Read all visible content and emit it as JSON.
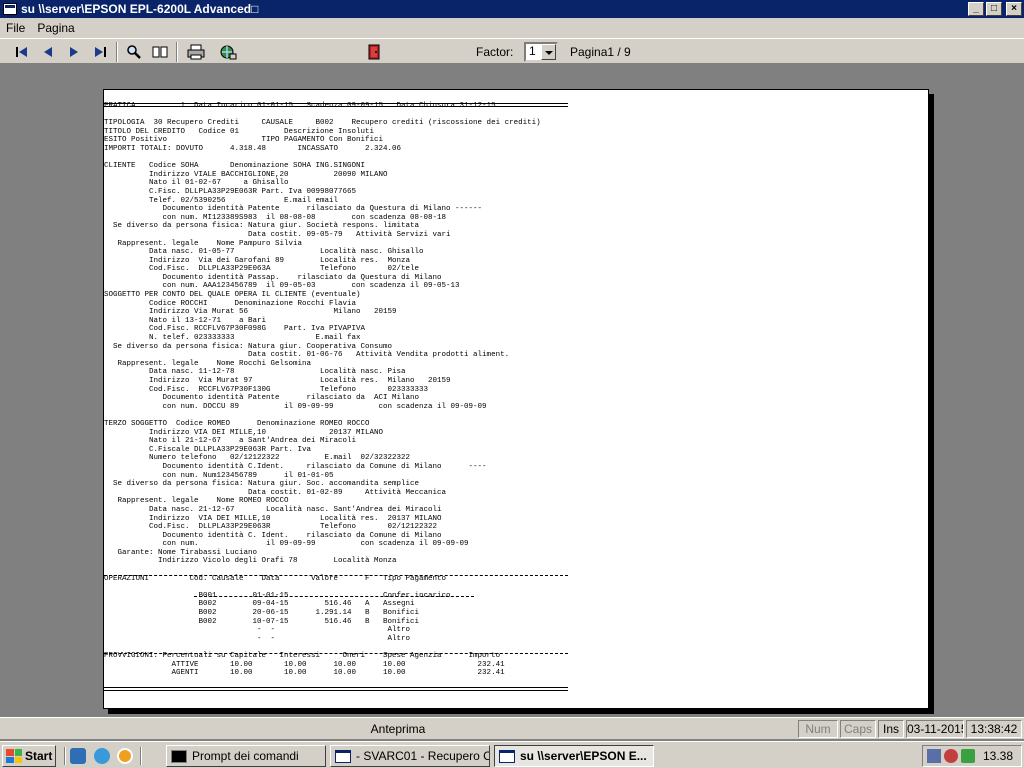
{
  "window": {
    "title": "su \\\\server\\EPSON EPL-6200L Advanced□"
  },
  "menu": [
    "File",
    "Pagina"
  ],
  "toolbar": {
    "factor_label": "Factor:",
    "factor_value": "1",
    "page_label": "Pagina1 / 9"
  },
  "report_lines": [
    "PRATICA          1  Data Incarico 01-01-15   Scadenza 09-09-15   Data Chiusura 31-12-15",
    "",
    "TIPOLOGIA  30 Recupero Crediti     CAUSALE     B002    Recupero crediti (riscossione dei crediti)",
    "TITOLO DEL CREDITO   Codice 01          Descrizione Insoluti",
    "ESITO Positivo                     TIPO PAGAMENTO Con Bonifici",
    "IMPORTI TOTALI: DOVUTO      4.318.48       INCASSATO      2.324.06",
    "",
    "CLIENTE   Codice SOHA       Denominazione SOHA ING.SINGONI",
    "          Indirizzo VIALE BACCHIGLIONE,20          20090 MILANO",
    "          Nato il 01-02-67     a Ghisallo",
    "          C.Fisc. DLLPLA33P29E063R Part. Iva 00998077665",
    "          Telef. 02/5390256             E.mail email",
    "             Documento identità Patente      rilasciato da Questura di Milano ------",
    "             con num. MI123389S983  il 08-08-08        con scadenza 08-08-18",
    "  Se diverso da persona fisica: Natura giur. Società respons. limitata",
    "                                Data costit. 09-05-79   Attività Servizi vari",
    "   Rappresent. legale    Nome Pampuro Silvia",
    "          Data nasc. 01-05-77                   Località nasc. Ghisallo",
    "          Indirizzo  Via dei Garofani 89        Località res.  Monza",
    "          Cod.Fisc.  DLLPLA33P29E063A           Telefono       02/tele",
    "             Documento identità Passap.    rilasciato da Questura di Milano",
    "             con num. AAA123456789  il 09-05-03        con scadenza il 09-05-13",
    "SOGGETTO PER CONTO DEL QUALE OPERA IL CLIENTE (eventuale)",
    "          Codice ROCCHI      Denominazione Rocchi Flavia",
    "          Indirizzo Via Murat 56                   Milano   20159",
    "          Nato il 13-12-71    a Bari",
    "          Cod.Fisc. RCCFLV67P30F098G    Part. Iva PIVAPIVA",
    "          N. telef. 023333333                  E.mail fax",
    "  Se diverso da persona fisica: Natura giur. Cooperativa Consumo",
    "                                Data costit. 01-06-76   Attività Vendita prodotti aliment.",
    "   Rappresent. legale    Nome Rocchi Gelsomina",
    "          Data nasc. 11-12-78                   Località nasc. Pisa",
    "          Indirizzo  Via Murat 97               Località res.  Milano   20159",
    "          Cod.Fisc.  RCCFLV67P30F130G           Telefono       023333333",
    "             Documento identità Patente      rilasciato da  ACI Milano",
    "             con num. DOCCU 89          il 09-09-99          con scadenza il 09-09-09",
    "",
    "TERZO SOGGETTO  Codice ROMEO      Denominazione ROMEO ROCCO",
    "          Indirizzo VIA DEI MILLE,10              20137 MILANO",
    "          Nato il 21-12-67    a Sant'Andrea dei Miracoli",
    "          C.Fiscale DLLPLA33P29E063R Part. Iva",
    "          Numero telefono   02/12122322          E.mail  02/32322322",
    "             Documento identità C.Ident.     rilasciato da Comune di Milano      ----",
    "             con num. Num123456789      il 01-01-05",
    "  Se diverso da persona fisica: Natura giur. Soc. accomandita semplice",
    "                                Data costit. 01-02-89     Attività Meccanica",
    "   Rappresent. legale    Nome ROMEO ROCCO",
    "          Data nasc. 21-12-67       Località nasc. Sant'Andrea dei Miracoli",
    "          Indirizzo  VIA DEI MILLE,10           Località res.  20137 MILANO",
    "          Cod.Fisc.  DLLPLA33P29E063R           Telefono       02/12122322",
    "             Documento identità C. Ident.    rilasciato da Comune di Milano",
    "             con num.               il 09-09-99          con scadenza il 09-09-09",
    "   Garante: Nome Tirabassi Luciano",
    "            Indirizzo Vicolo degli Orafi 78        Località Monza",
    "",
    "OPERAZIONI         Cod. Causale    Data       Valore      F   Tipo Pagamento",
    "",
    "                     B001        01-01-15                     Confer.incarico",
    "                     B002        09-04-15        516.46   A   Assegni",
    "                     B002        20-06-15      1.291.14   B   Bonifici",
    "                     B002        10-07-15        516.46   B   Bonifici",
    "                                  -  -                         Altro",
    "                                  -  -                         Altro",
    "",
    "PROVVIGIONI: Percentuali su Capitale   Interessi     Oneri    Spese Agenzia      Importo",
    "               ATTIVE       10.00       10.00      10.00      10.00                232.41",
    "               AGENTI       10.00       10.00      10.00      10.00                232.41"
  ],
  "statusbar": {
    "mode": "Anteprima",
    "num": "Num",
    "caps": "Caps",
    "ins": "Ins",
    "date": "03-11-2015",
    "time": "13:38:42"
  },
  "taskbar": {
    "start": "Start",
    "tasks": [
      "Prompt dei comandi",
      "- SVARC01 - Recupero C...",
      "su \\\\server\\EPSON E..."
    ],
    "clock": "13.38"
  },
  "colors": {
    "titlebar": "#0a246a",
    "face": "#d4d0c8",
    "workspace": "#808080"
  }
}
